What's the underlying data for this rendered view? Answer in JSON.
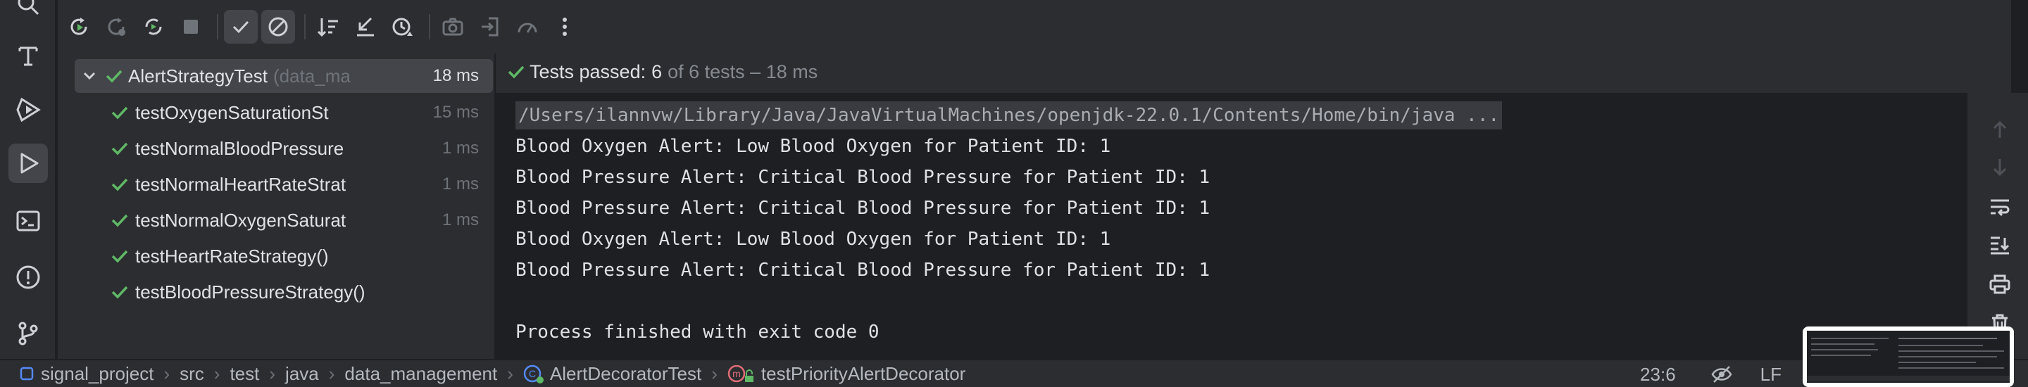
{
  "toolbar": {
    "buttons": [
      {
        "icon": "rerun-icon"
      },
      {
        "icon": "rerun-failed-icon"
      },
      {
        "icon": "rerun-automatically-icon"
      },
      {
        "icon": "stop-icon"
      },
      {
        "icon": "show-passed-icon"
      },
      {
        "icon": "show-ignored-icon"
      },
      {
        "icon": "sort-alphabetically-icon"
      },
      {
        "icon": "collapse-all-icon"
      },
      {
        "icon": "sort-by-duration-icon"
      },
      {
        "icon": "screenshot-icon"
      },
      {
        "icon": "import-tests-icon"
      },
      {
        "icon": "coverage-icon"
      },
      {
        "icon": "more-options-icon"
      }
    ]
  },
  "tree": {
    "root": {
      "name": "AlertStrategyTest",
      "package": "(data_ma",
      "duration": "18 ms"
    },
    "tests": [
      {
        "name": "testOxygenSaturationSt",
        "duration": "15 ms"
      },
      {
        "name": "testNormalBloodPressure",
        "duration": "1 ms"
      },
      {
        "name": "testNormalHeartRateStrat",
        "duration": "1 ms"
      },
      {
        "name": "testNormalOxygenSaturat",
        "duration": "1 ms"
      },
      {
        "name": "testHeartRateStrategy()",
        "duration": ""
      },
      {
        "name": "testBloodPressureStrategy()",
        "duration": ""
      }
    ]
  },
  "status": {
    "label": "Tests passed:",
    "count": "6",
    "rest": "of 6 tests – 18 ms"
  },
  "console": {
    "command": "/Users/ilannvw/Library/Java/JavaVirtualMachines/openjdk-22.0.1/Contents/Home/bin/java ...",
    "lines": [
      "Blood Oxygen Alert: Low Blood Oxygen for Patient ID: 1",
      "Blood Pressure Alert: Critical Blood Pressure for Patient ID: 1",
      "Blood Pressure Alert: Critical Blood Pressure for Patient ID: 1",
      "Blood Oxygen Alert: Low Blood Oxygen for Patient ID: 1",
      "Blood Pressure Alert: Critical Blood Pressure for Patient ID: 1",
      "",
      "Process finished with exit code 0"
    ]
  },
  "breadcrumb": {
    "items": [
      "signal_project",
      "src",
      "test",
      "java",
      "data_management",
      "AlertDecoratorTest",
      "testPriorityAlertDecorator"
    ]
  },
  "statusbar": {
    "position": "23:6",
    "line_separator": "LF"
  },
  "colors": {
    "pass_green": "#5fb865",
    "background": "#1e1f22",
    "panel": "#2b2d30"
  }
}
